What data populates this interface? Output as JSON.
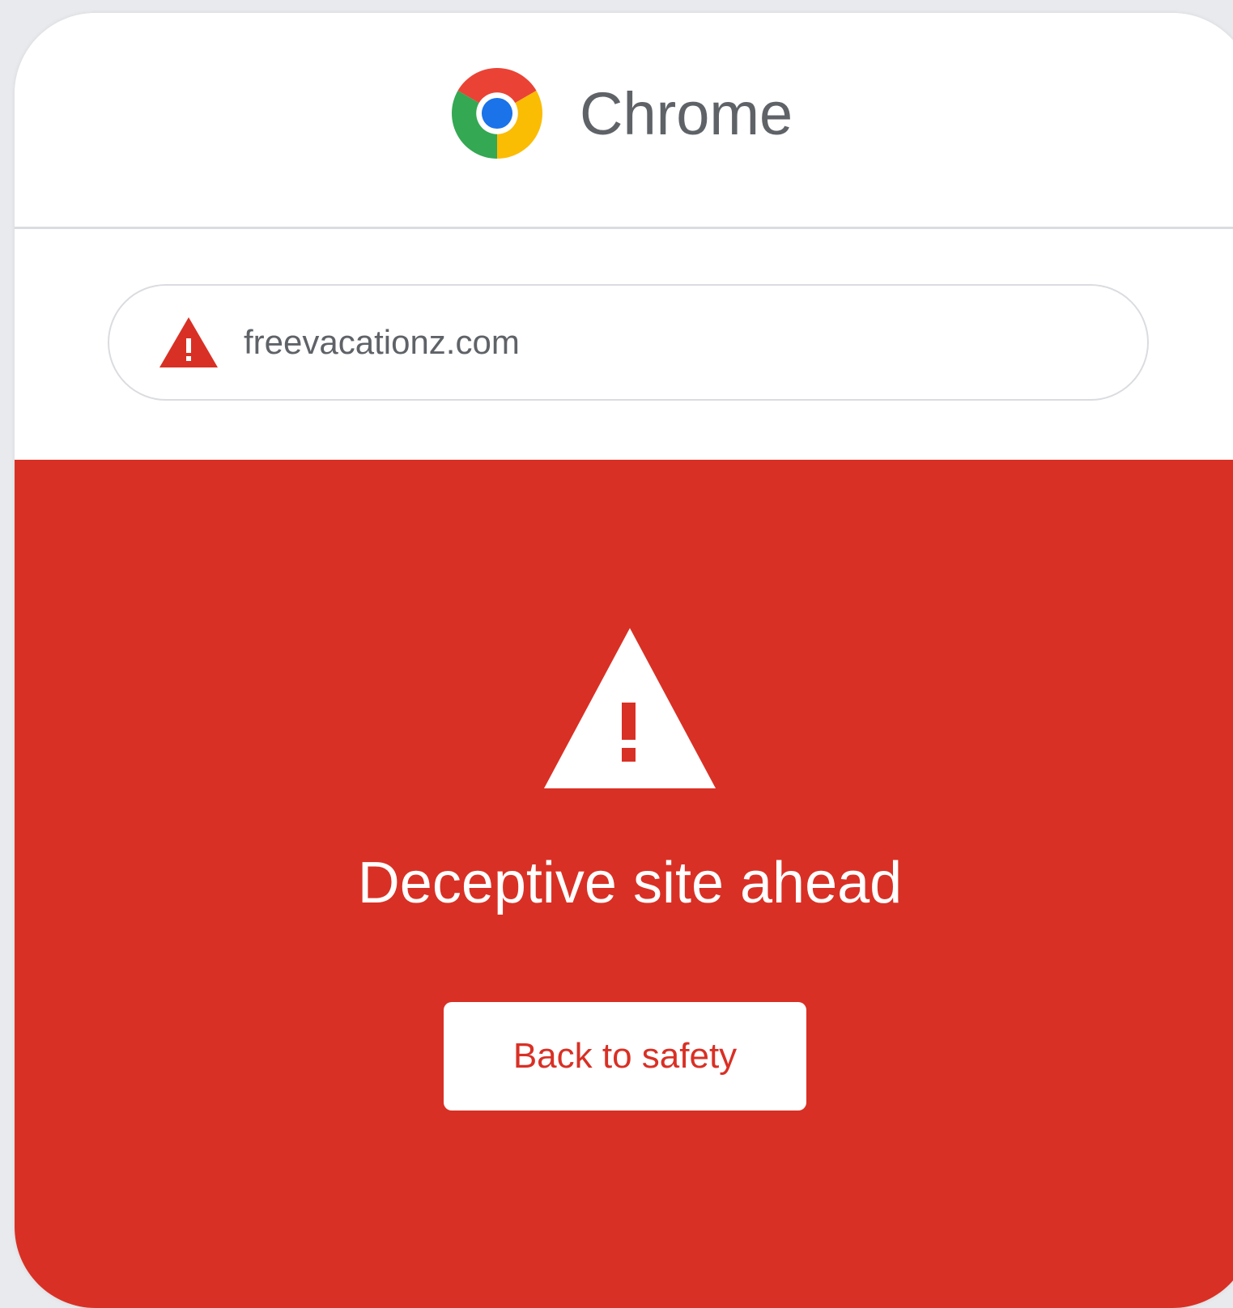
{
  "browser": {
    "name": "Chrome",
    "logo_icon": "chrome-logo-icon"
  },
  "omnibox": {
    "url": "freevacationz.com",
    "icon": "warning-triangle-icon"
  },
  "interstitial": {
    "icon": "warning-triangle-icon",
    "headline": "Deceptive site ahead",
    "back_button_label": "Back to safety"
  },
  "colors": {
    "warning_red": "#d93025",
    "chrome_red": "#ea4335",
    "chrome_yellow": "#fbbc04",
    "chrome_green": "#34a853",
    "chrome_blue": "#1a73e8",
    "text_gray": "#5f6368",
    "divider": "#dadce0"
  }
}
